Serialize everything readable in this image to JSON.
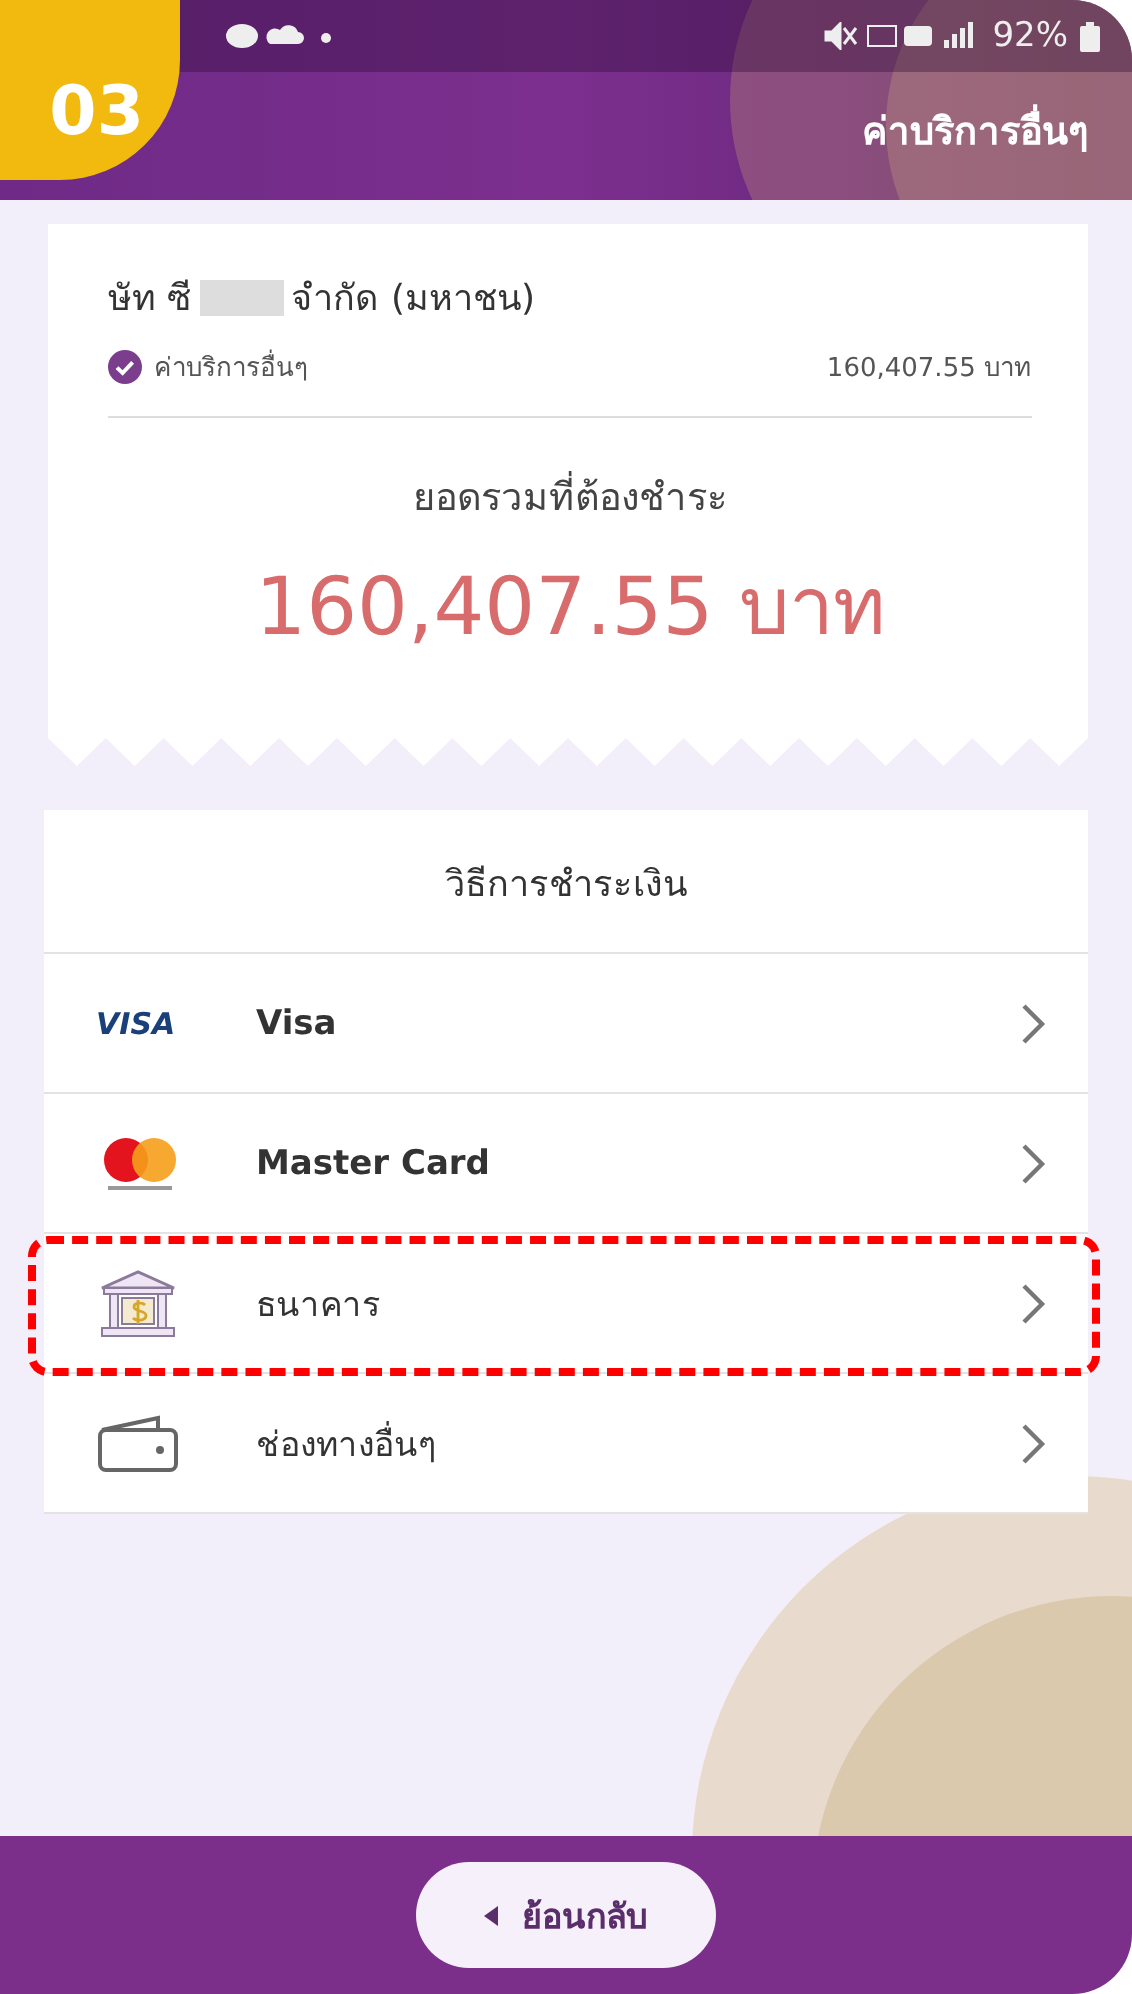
{
  "step_badge": "03",
  "status_bar": {
    "battery": "92%"
  },
  "header": {
    "title": "ค่าบริการอื่นๆ"
  },
  "receipt": {
    "company_start": "ษัท ซี",
    "company_end": "จำกัด (มหาชน)",
    "service": "ค่าบริการอื่นๆ",
    "service_amount": "160,407.55 บาท",
    "total_label": "ยอดรวมที่ต้องชำระ",
    "total": "160,407.55 บาท"
  },
  "payment": {
    "title": "วิธีการชำระเงิน",
    "methods": [
      {
        "kind": "visa",
        "logo": "VISA",
        "label": "Visa",
        "highlighted": false
      },
      {
        "kind": "mastercard",
        "label": "Master Card",
        "highlighted": false
      },
      {
        "kind": "bank",
        "label": "ธนาคาร",
        "highlighted": true
      },
      {
        "kind": "wallet",
        "label": "ช่องทางอื่นๆ",
        "highlighted": false
      }
    ]
  },
  "back_button": {
    "label": "ย้อนกลับ"
  }
}
